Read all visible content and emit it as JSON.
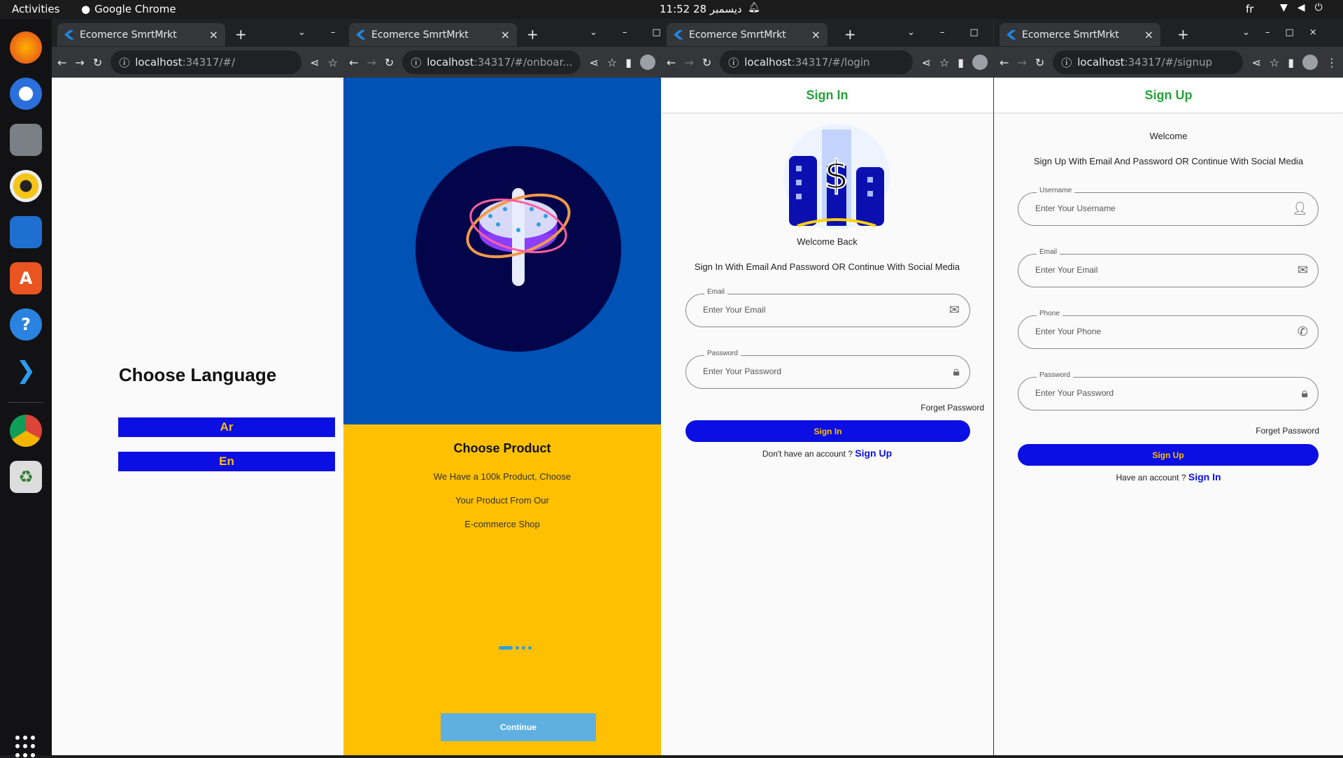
{
  "topbar": {
    "activities": "Activities",
    "app_name": "Google Chrome",
    "clock": "11:52  28 ديسمبر",
    "lang": "fr"
  },
  "dock": {
    "items": [
      "firefox-icon",
      "thunderbird-icon",
      "files-icon",
      "rhythmbox-icon",
      "writer-icon",
      "app-center-icon",
      "help-icon",
      "vscode-icon",
      "chrome-icon",
      "trash-icon",
      "app-grid-icon"
    ]
  },
  "windows": [
    {
      "tab_title": "Ecomerce SmrtMrkt",
      "url_host": "localhost",
      "url_path": ":34317/#/"
    },
    {
      "tab_title": "Ecomerce SmrtMrkt",
      "url_host": "localhost",
      "url_path": ":34317/#/onboar..."
    },
    {
      "tab_title": "Ecomerce SmrtMrkt",
      "url_host": "localhost",
      "url_path": ":34317/#/login"
    },
    {
      "tab_title": "Ecomerce SmrtMrkt",
      "url_host": "localhost",
      "url_path": ":34317/#/signup"
    }
  ],
  "language": {
    "title": "Choose Language",
    "ar": "Ar",
    "en": "En"
  },
  "onboarding": {
    "title": "Choose Product",
    "line1": "We Have a 100k Product, Choose",
    "line2": "Your Product From Our",
    "line3": "E-commerce Shop",
    "continue": "Continue",
    "page_count": 4,
    "active_page": 0
  },
  "login": {
    "header": "Sign In",
    "welcome": "Welcome Back",
    "subtitle": "Sign In With Email And Password OR Continue With Social Media",
    "email_label": "Email",
    "email_placeholder": "Enter Your Email",
    "password_label": "Password",
    "password_placeholder": "Enter Your Password",
    "forget": "Forget Password",
    "button": "Sign In",
    "prompt": "Don't have an account ? ",
    "link": "Sign Up"
  },
  "signup": {
    "header": "Sign Up",
    "welcome": "Welcome",
    "subtitle": "Sign Up With Email And Password OR Continue With Social Media",
    "username_label": "Username",
    "username_placeholder": "Enter Your Username",
    "email_label": "Email",
    "email_placeholder": "Enter Your Email",
    "phone_label": "Phone",
    "phone_placeholder": "Enter Your Phone",
    "password_label": "Password",
    "password_placeholder": "Enter Your Password",
    "forget": "Forget Password",
    "button": "Sign Up",
    "prompt": "Have an account ? ",
    "link": "Sign In"
  },
  "colors": {
    "primary_blue": "#0b0fe3",
    "accent_yellow": "#ffbf00",
    "header_green": "#25a13a",
    "onboard_blue": "#0052b4"
  }
}
